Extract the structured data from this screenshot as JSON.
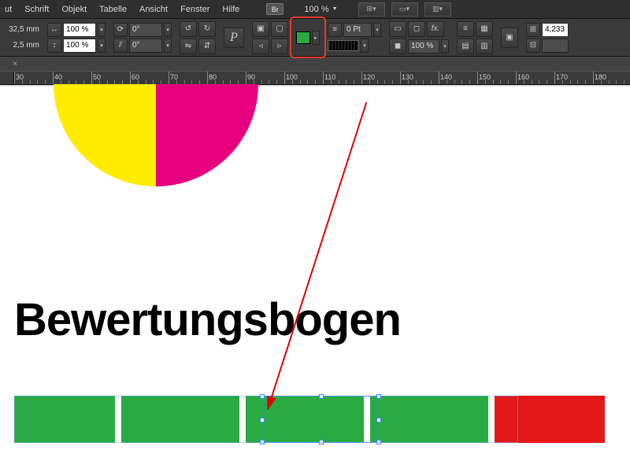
{
  "menu": {
    "items": [
      "ut",
      "Schrift",
      "Objekt",
      "Tabelle",
      "Ansicht",
      "Fenster",
      "Hilfe"
    ],
    "bridge": "Br",
    "zoom": "100 %"
  },
  "ctrl": {
    "xy": {
      "x": "32,5 mm",
      "y": "2,5 mm"
    },
    "scale": {
      "w": "100 %",
      "h": "100 %"
    },
    "rotate": "0°",
    "shear": "0°",
    "p_icon": "P",
    "stroke_weight": "0 Pt",
    "opacity": "100 %",
    "right_num": "4,233"
  },
  "ruler": {
    "ticks": [
      30,
      40,
      50,
      60,
      70,
      80,
      90,
      100,
      110,
      120,
      130,
      140,
      150,
      160,
      170,
      180
    ]
  },
  "doc": {
    "title": "Bewertungsbogen",
    "colors": {
      "green": "#2aaa42",
      "red": "#e31818",
      "yellow": "#ffec00",
      "magenta": "#e6007e"
    }
  }
}
